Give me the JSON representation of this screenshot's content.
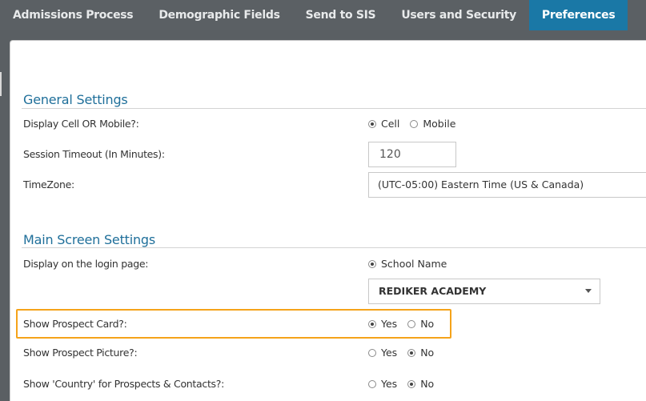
{
  "tabs": [
    {
      "label": "Admissions Process"
    },
    {
      "label": "Demographic Fields"
    },
    {
      "label": "Send to SIS"
    },
    {
      "label": "Users and Security"
    },
    {
      "label": "Preferences"
    }
  ],
  "general": {
    "title": "General Settings",
    "display_cell": {
      "label": "Display Cell OR Mobile?:",
      "opt1": "Cell",
      "opt2": "Mobile",
      "selected": "Cell"
    },
    "session_timeout": {
      "label": "Session Timeout (In Minutes):",
      "value": "120"
    },
    "timezone": {
      "label": "TimeZone:",
      "value": "(UTC-05:00) Eastern Time (US & Canada)"
    }
  },
  "main": {
    "title": "Main Screen Settings",
    "login_page": {
      "label": "Display on the login page:",
      "opt1": "School Name",
      "selected": "School Name",
      "school": "REDIKER ACADEMY"
    },
    "prospect_card": {
      "label": "Show Prospect Card?:",
      "yes": "Yes",
      "no": "No",
      "selected": "Yes"
    },
    "prospect_picture": {
      "label": "Show Prospect Picture?:",
      "yes": "Yes",
      "no": "No",
      "selected": "No"
    },
    "country": {
      "label": "Show 'Country' for Prospects & Contacts?:",
      "yes": "Yes",
      "no": "No",
      "selected": "No"
    }
  },
  "colors": {
    "active_tab": "#1a78a6",
    "section_title": "#1f6f9a",
    "highlight": "#f5a31a"
  }
}
